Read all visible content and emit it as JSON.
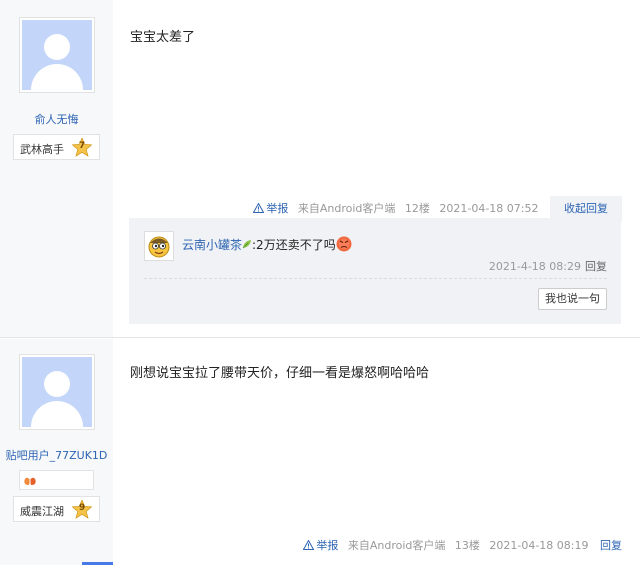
{
  "posts": [
    {
      "username": "俞人无悔",
      "level_title": "武林高手",
      "level_num": "7",
      "content": "宝宝太差了",
      "report_label": "举报",
      "source": "来自Android客户端",
      "floor": "12楼",
      "time": "2021-04-18 07:52",
      "collapse_label": "收起回复",
      "reply": {
        "username": "云南小罐茶",
        "text": ":2万还卖不了吗",
        "time": "2021-4-18 08:29",
        "reply_label": "回复",
        "say_label": "我也说一句"
      }
    },
    {
      "username": "贴吧用户_77ZUK1D",
      "level_title": "威震江湖",
      "level_num": "9",
      "content": "刚想说宝宝拉了腰带天价，仔细一看是爆怒啊哈哈哈",
      "report_label": "举报",
      "source": "来自Android客户端",
      "floor": "13楼",
      "time": "2021-04-18 08:19",
      "reply_label": "回复"
    }
  ],
  "colors": {
    "link": "#2d64b3",
    "sidebar_bg": "#f7f8fa",
    "reply_bg": "#f0f2f5",
    "avatar_placeholder": "#c3d6f9"
  }
}
